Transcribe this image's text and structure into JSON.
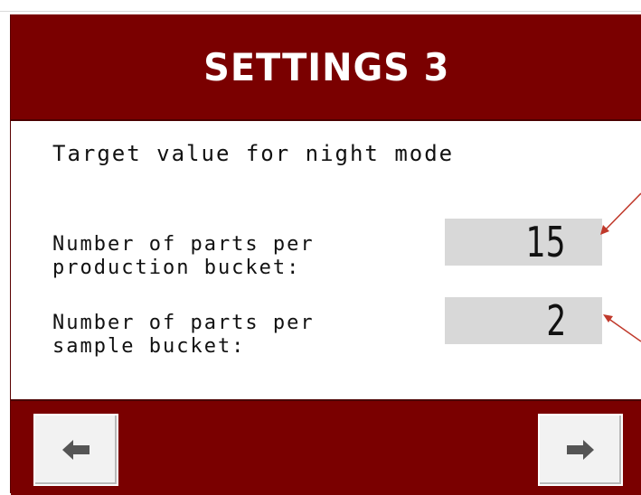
{
  "screen": {
    "title": "SETTINGS 3",
    "subtitle": "Target value for night mode"
  },
  "fields": [
    {
      "label_line1": "Number of parts per",
      "label_line2": "production bucket:",
      "value": "15"
    },
    {
      "label_line1": "Number of parts per",
      "label_line2": "sample bucket:",
      "value": "2"
    }
  ],
  "navigation": {
    "prev_icon": "arrow-left-icon",
    "next_icon": "arrow-right-icon"
  },
  "colors": {
    "header_bg": "#7a0000",
    "field_bg": "#d8d8d8",
    "callout_arrow": "#c0392b"
  }
}
